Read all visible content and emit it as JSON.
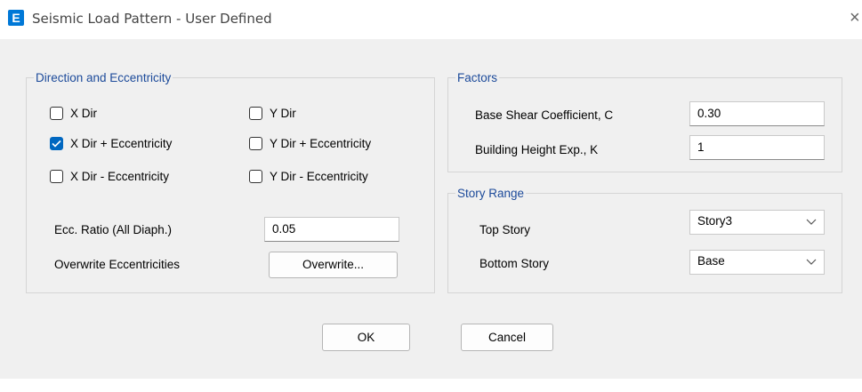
{
  "window": {
    "app_icon_letter": "E",
    "title": "Seismic Load Pattern - User Defined",
    "close_glyph": "×"
  },
  "direction_group": {
    "title": "Direction and Eccentricity",
    "options": [
      {
        "label": "X Dir",
        "checked": false
      },
      {
        "label": "X Dir + Eccentricity",
        "checked": true
      },
      {
        "label": "X Dir - Eccentricity",
        "checked": false
      },
      {
        "label": "Y Dir",
        "checked": false
      },
      {
        "label": "Y Dir + Eccentricity",
        "checked": false
      },
      {
        "label": "Y Dir - Eccentricity",
        "checked": false
      }
    ],
    "ecc_ratio_label": "Ecc. Ratio (All Diaph.)",
    "ecc_ratio_value": "0.05",
    "overwrite_label": "Overwrite Eccentricities",
    "overwrite_button": "Overwrite..."
  },
  "factors_group": {
    "title": "Factors",
    "base_shear_label": "Base Shear Coefficient, C",
    "base_shear_value": "0.30",
    "height_exp_label": "Building Height Exp., K",
    "height_exp_value": "1"
  },
  "story_group": {
    "title": "Story Range",
    "top_label": "Top Story",
    "top_value": "Story3",
    "bottom_label": "Bottom Story",
    "bottom_value": "Base"
  },
  "buttons": {
    "ok": "OK",
    "cancel": "Cancel"
  },
  "colors": {
    "accent": "#0067c0",
    "group_title": "#1c4a9a",
    "dialog_bg": "#f0f0f0"
  }
}
